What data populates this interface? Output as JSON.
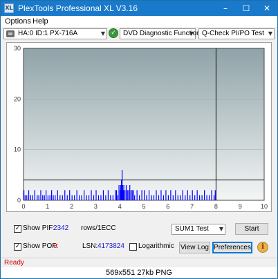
{
  "window": {
    "title": "PlexTools Professional XL V3.16",
    "app_icon_text": "XL",
    "minimize": "–",
    "maximize": "☐",
    "close": "✕"
  },
  "menu": {
    "items": [
      "Options",
      "Help"
    ]
  },
  "toolbar": {
    "drive": "HA:0 ID:1  PX-716A",
    "function": "DVD Diagnostic Functions",
    "test": "Q-Check PI/PO Test",
    "dropdown_arrow": "▼",
    "go_glyph": "✓"
  },
  "chart_data": {
    "type": "bar",
    "title": "",
    "xlabel": "",
    "ylabel": "",
    "xlim": [
      0,
      10
    ],
    "ylim": [
      0,
      30
    ],
    "x_ticks": [
      "0",
      "1",
      "2",
      "3",
      "4",
      "5",
      "6",
      "7",
      "8",
      "9",
      "10"
    ],
    "y_ticks": [
      "0",
      "10",
      "20",
      "30"
    ],
    "threshold_line": 4,
    "disc_end_marker": 8,
    "series": [
      {
        "color": "#0000ff",
        "x": [
          0.0,
          0.05,
          0.12,
          0.2,
          0.28,
          0.35,
          0.45,
          0.55,
          0.62,
          0.7,
          0.78,
          0.85,
          0.92,
          1.0,
          1.08,
          1.15,
          1.22,
          1.3,
          1.4,
          1.5,
          1.6,
          1.7,
          1.8,
          1.9,
          2.0,
          2.1,
          2.2,
          2.3,
          2.4,
          2.5,
          2.6,
          2.7,
          2.8,
          2.9,
          3.0,
          3.1,
          3.2,
          3.3,
          3.4,
          3.5,
          3.6,
          3.7,
          3.8,
          3.85,
          3.9,
          3.95,
          4.0,
          4.02,
          4.05,
          4.08,
          4.1,
          4.12,
          4.15,
          4.2,
          4.25,
          4.3,
          4.35,
          4.4,
          4.45,
          4.5,
          4.55,
          4.6,
          4.7,
          4.8,
          4.9,
          5.0,
          5.1,
          5.2,
          5.3,
          5.4,
          5.5,
          5.6,
          5.7,
          5.8,
          5.9,
          6.0,
          6.1,
          6.2,
          6.3,
          6.4,
          6.5,
          6.6,
          6.7,
          6.8,
          6.9,
          7.0,
          7.1,
          7.2,
          7.3,
          7.4,
          7.5,
          7.6,
          7.7,
          7.8,
          7.9,
          7.95
        ],
        "values": [
          2,
          1,
          1,
          2,
          1,
          1,
          2,
          1,
          1,
          2,
          1,
          1,
          2,
          1,
          1,
          2,
          1,
          1,
          2,
          1,
          1,
          2,
          1,
          2,
          1,
          1,
          2,
          1,
          1,
          2,
          1,
          1,
          2,
          1,
          2,
          1,
          1,
          2,
          1,
          2,
          1,
          1,
          2,
          2,
          1,
          3,
          2,
          3,
          4,
          6,
          3,
          2,
          3,
          2,
          3,
          2,
          2,
          3,
          2,
          2,
          2,
          1,
          2,
          1,
          2,
          2,
          1,
          2,
          1,
          1,
          2,
          1,
          2,
          1,
          2,
          1,
          2,
          1,
          2,
          1,
          1,
          2,
          1,
          2,
          1,
          2,
          1,
          2,
          1,
          1,
          2,
          1,
          1,
          2,
          1,
          2
        ]
      }
    ]
  },
  "controls": {
    "show_pif_label": "Show PIF:",
    "pif_value": "2342",
    "rows_label": "rows/1ECC",
    "show_pof_label": "Show POF:",
    "pof_value": "0",
    "lsn_label": "LSN:",
    "lsn_value": "4173824",
    "logarithmic_label": "Logarithmic",
    "sum_select": "SUM1 Test",
    "start_button": "Start",
    "view_log_button": "View Log",
    "preferences_button": "Preferences",
    "info_glyph": "i",
    "check_glyph": "✓"
  },
  "status": {
    "text": "Ready"
  },
  "caption": "569x551 27kb PNG"
}
